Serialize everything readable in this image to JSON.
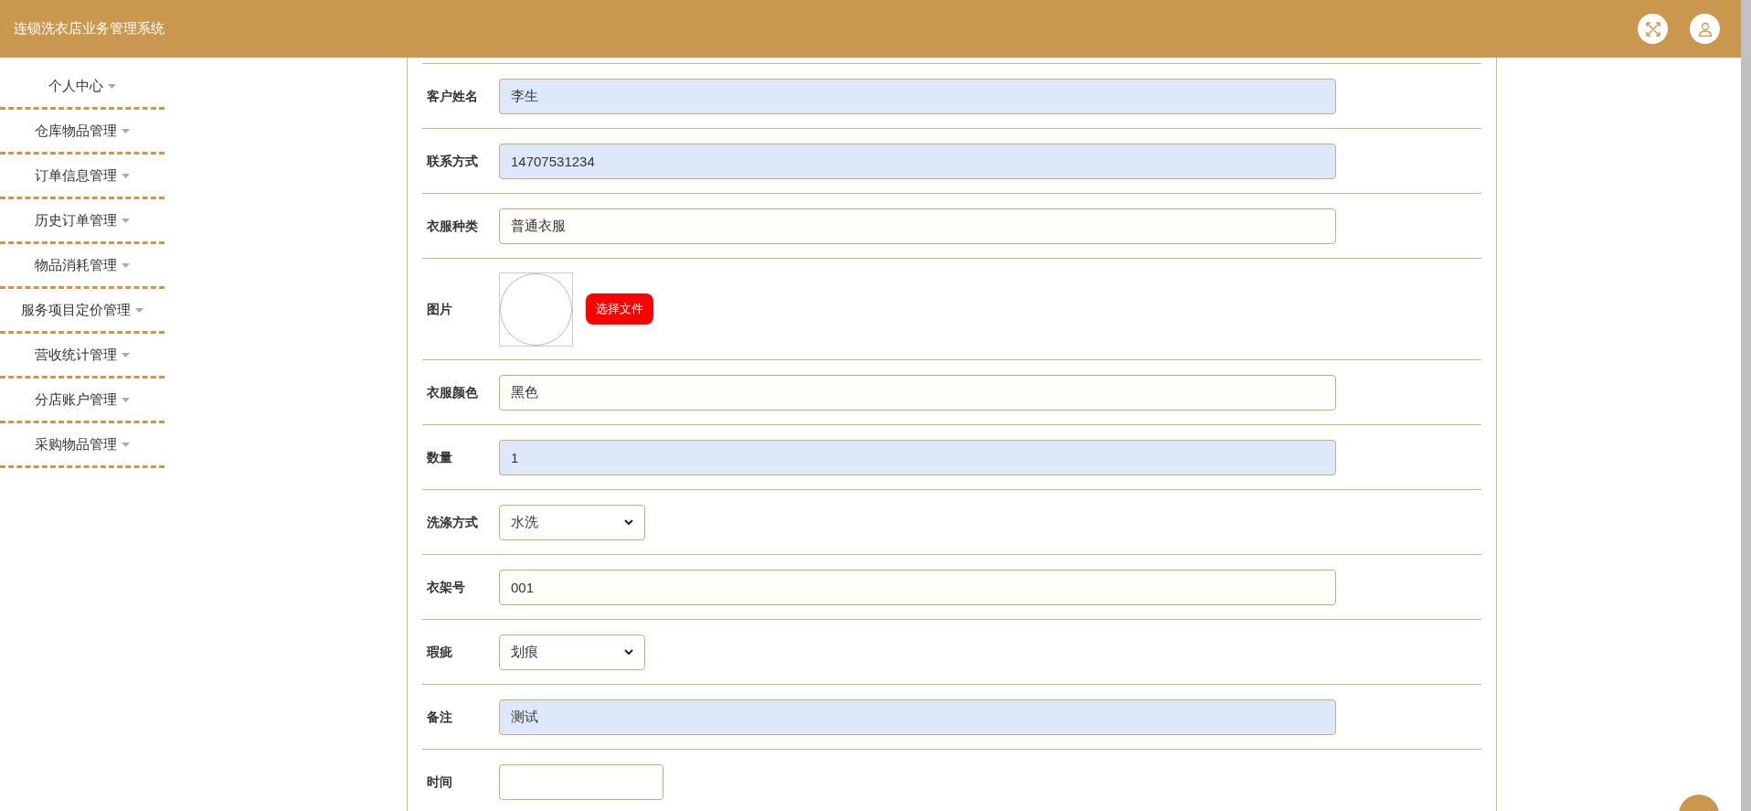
{
  "header": {
    "title": "连锁洗衣店业务管理系统"
  },
  "sidebar": {
    "items": [
      {
        "label": "个人中心"
      },
      {
        "label": "仓库物品管理"
      },
      {
        "label": "订单信息管理"
      },
      {
        "label": "历史订单管理"
      },
      {
        "label": "物品消耗管理"
      },
      {
        "label": "服务项目定价管理"
      },
      {
        "label": "营收统计管理"
      },
      {
        "label": "分店账户管理"
      },
      {
        "label": "采购物品管理"
      }
    ]
  },
  "form": {
    "fields": [
      {
        "kind": "text",
        "label": "客户姓名",
        "value": "李生",
        "autofilled": true
      },
      {
        "kind": "text",
        "label": "联系方式",
        "value": "14707531234",
        "autofilled": true
      },
      {
        "kind": "text",
        "label": "衣服种类",
        "value": "普通衣服",
        "autofilled": false
      },
      {
        "kind": "image",
        "label": "图片",
        "button": "选择文件"
      },
      {
        "kind": "text",
        "label": "衣服颜色",
        "value": "黑色",
        "autofilled": false
      },
      {
        "kind": "text",
        "label": "数量",
        "value": "1",
        "autofilled": true
      },
      {
        "kind": "select",
        "label": "洗涤方式",
        "value": "水洗"
      },
      {
        "kind": "text",
        "label": "衣架号",
        "value": "001",
        "autofilled": false
      },
      {
        "kind": "select",
        "label": "瑕疵",
        "value": "划痕"
      },
      {
        "kind": "text",
        "label": "备注",
        "value": "测试",
        "autofilled": true
      },
      {
        "kind": "date",
        "label": "时间"
      }
    ]
  }
}
